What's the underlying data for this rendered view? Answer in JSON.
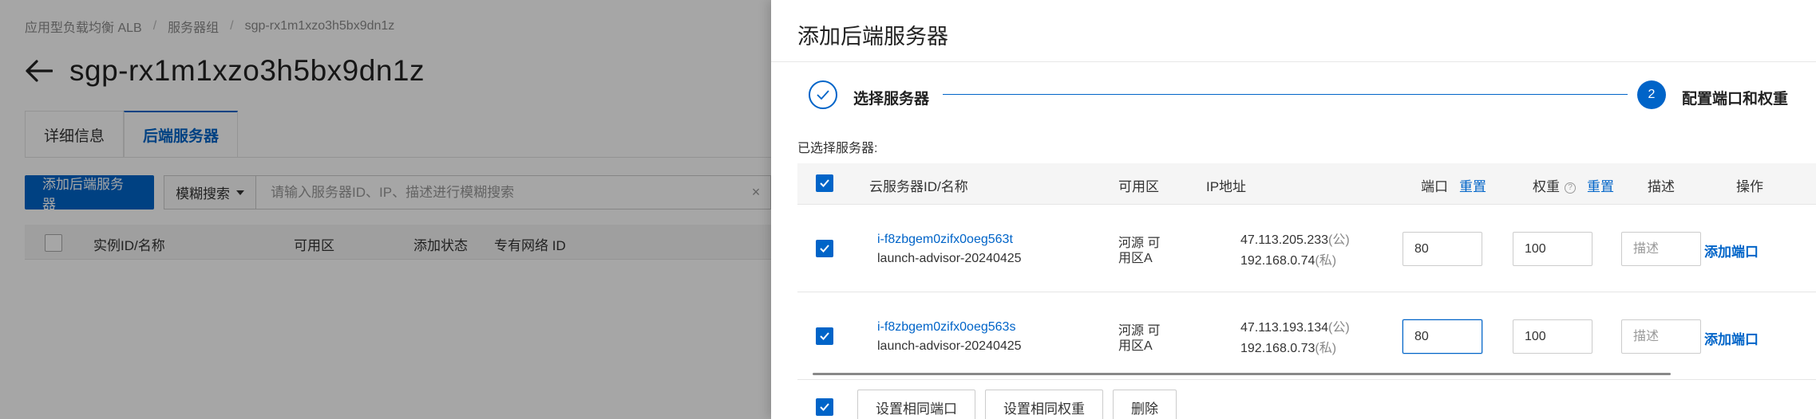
{
  "breadcrumb": [
    "应用型负载均衡 ALB",
    "服务器组",
    "sgp-rx1m1xzo3h5bx9dn1z"
  ],
  "page_title": "sgp-rx1m1xzo3h5bx9dn1z",
  "tabs": [
    {
      "label": "详细信息",
      "active": false
    },
    {
      "label": "后端服务器",
      "active": true
    }
  ],
  "toolbar": {
    "add_button": "添加后端服务器",
    "search_mode": "模糊搜索",
    "search_placeholder": "请输入服务器ID、IP、描述进行模糊搜索",
    "clear_symbol": "×"
  },
  "bg_table": {
    "headers": [
      "实例ID/名称",
      "可用区",
      "添加状态",
      "专有网络 ID"
    ]
  },
  "drawer": {
    "title": "添加后端服务器",
    "steps": [
      {
        "label": "选择服务器",
        "status": "done"
      },
      {
        "label": "配置端口和权重",
        "number": "2",
        "status": "active"
      }
    ],
    "selected_label": "已选择服务器:",
    "table": {
      "headers": {
        "id_name": "云服务器ID/名称",
        "zone": "可用区",
        "ip": "IP地址",
        "port": "端口",
        "port_reset": "重置",
        "weight": "权重",
        "weight_reset": "重置",
        "description": "描述",
        "action": "操作"
      },
      "rows": [
        {
          "id": "i-f8zbgem0zifx0oeg563t",
          "name": "launch-advisor-20240425",
          "zone": "河源 可用区A",
          "public_ip": "47.113.205.233",
          "public_tag": "(公)",
          "private_ip": "192.168.0.74",
          "private_tag": "(私)",
          "port": "80",
          "weight": "100",
          "description_placeholder": "描述",
          "action": "添加端口"
        },
        {
          "id": "i-f8zbgem0zifx0oeg563s",
          "name": "launch-advisor-20240425",
          "zone": "河源 可用区A",
          "public_ip": "47.113.193.134",
          "public_tag": "(公)",
          "private_ip": "192.168.0.73",
          "private_tag": "(私)",
          "port": "80",
          "weight": "100",
          "description_placeholder": "描述",
          "action": "添加端口"
        }
      ]
    },
    "bottom_buttons": [
      "设置相同端口",
      "设置相同权重",
      "删除"
    ]
  },
  "colors": {
    "primary": "#0064c8",
    "overlay": "rgba(0,0,0,0.35)"
  }
}
